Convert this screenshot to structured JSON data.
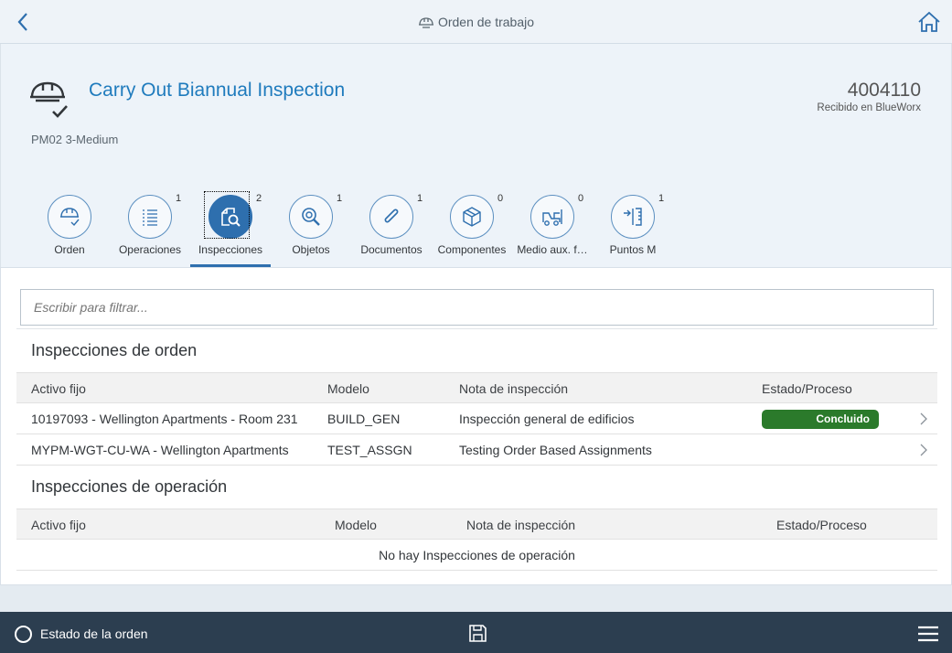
{
  "shell": {
    "title": "Orden de trabajo",
    "back_icon": "chevron-left-icon",
    "home_icon": "home-icon",
    "title_icon": "hardhat-icon"
  },
  "header": {
    "title": "Carry Out Biannual Inspection",
    "subtitle": "PM02 3-Medium",
    "number": "4004110",
    "status": "Recibido en BlueWorx",
    "title_color": "#1f7bbd"
  },
  "tabs": [
    {
      "label": "Orden",
      "count": ""
    },
    {
      "label": "Operaciones",
      "count": "1"
    },
    {
      "label": "Inspecciones",
      "count": "2"
    },
    {
      "label": "Objetos",
      "count": "1"
    },
    {
      "label": "Documentos",
      "count": "1"
    },
    {
      "label": "Componentes",
      "count": "0"
    },
    {
      "label": "Medio aux. f…",
      "count": "0"
    },
    {
      "label": "Puntos M",
      "count": "1"
    }
  ],
  "active_tab": "Inspecciones",
  "filter": {
    "placeholder": "Escribir para filtrar..."
  },
  "order_inspections": {
    "title": "Inspecciones de orden",
    "columns": [
      "Activo fijo",
      "Modelo",
      "Nota de inspección",
      "Estado/Proceso"
    ],
    "rows": [
      {
        "asset": "10197093 - Wellington Apartments - Room 231",
        "model": "BUILD_GEN",
        "note": "Inspección general de edificios",
        "status": "Concluido"
      },
      {
        "asset": "MYPM-WGT-CU-WA - Wellington Apartments",
        "model": "TEST_ASSGN",
        "note": "Testing Order Based Assignments",
        "status": ""
      }
    ]
  },
  "operation_inspections": {
    "title": "Inspecciones de operación",
    "columns": [
      "Activo fijo",
      "Modelo",
      "Nota de inspección",
      "Estado/Proceso"
    ],
    "empty_text": "No hay Inspecciones de operación"
  },
  "footer": {
    "status_label": "Estado de la orden",
    "save_icon": "save-icon",
    "menu_icon": "menu-icon"
  },
  "colors": {
    "accent": "#2e6fae",
    "status_done": "#2b7a2b",
    "footer_bg": "#2c3e50"
  }
}
